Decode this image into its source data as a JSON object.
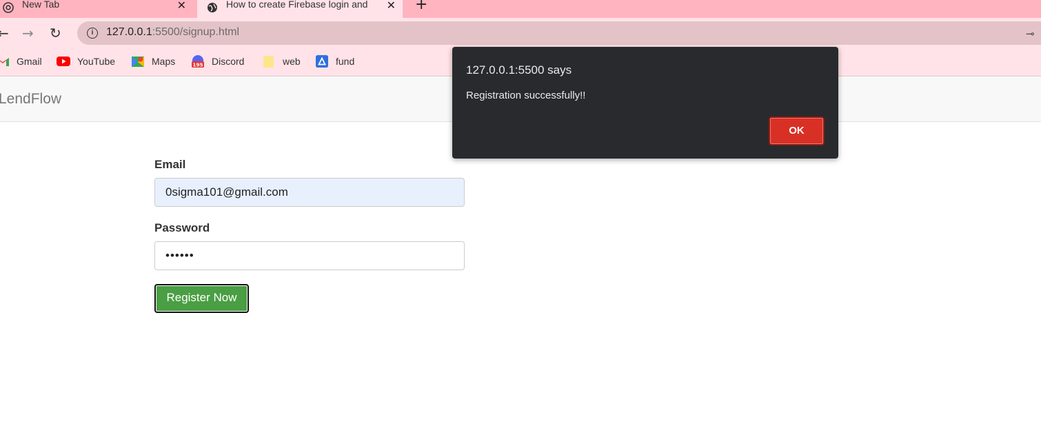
{
  "browser": {
    "tabs": [
      {
        "title": "New Tab",
        "active": false
      },
      {
        "title": "How to create Firebase login and",
        "active": true
      }
    ],
    "new_tab_symbol": "+",
    "close_symbol": "✕",
    "url_host": "127.0.0.1",
    "url_rest": ":5500/signup.html",
    "bookmarks": [
      {
        "label": "Gmail",
        "icon": "gmail-icon"
      },
      {
        "label": "YouTube",
        "icon": "youtube-icon"
      },
      {
        "label": "Maps",
        "icon": "maps-icon"
      },
      {
        "label": "Discord",
        "icon": "discord-icon",
        "badge": "195"
      },
      {
        "label": "web",
        "icon": "folder-icon"
      },
      {
        "label": "fund",
        "icon": "drive-icon"
      }
    ]
  },
  "page": {
    "brand": "LendFlow",
    "email_label": "Email",
    "email_value": "0sigma101@gmail.com",
    "password_label": "Password",
    "password_value": "••••••",
    "register_label": "Register Now"
  },
  "dialog": {
    "title": "127.0.0.1:5500 says",
    "message": "Registration successfully!!",
    "ok_label": "OK"
  },
  "colors": {
    "tabstrip": "#ffb4c0",
    "toolbar": "#ffe3e8",
    "register_button": "#4a9e43",
    "dialog_bg": "#292a2d",
    "ok_button": "#d93025"
  }
}
